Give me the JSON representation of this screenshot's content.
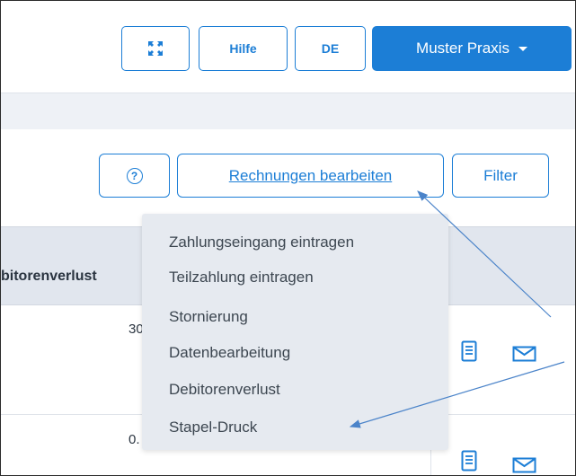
{
  "header": {
    "fullscreen_icon": "expand-arrows-icon",
    "help_label": "Hilfe",
    "lang_label": "DE",
    "practice_label": "Muster Praxis"
  },
  "toolbar": {
    "help_glyph": "?",
    "edit_invoices_label": "Rechnungen bearbeiten",
    "filter_label": "Filter"
  },
  "table": {
    "column_header": "bitorenverlust",
    "rows": [
      {
        "value": "30"
      },
      {
        "value": "0."
      }
    ]
  },
  "menu": {
    "items": [
      "Zahlungseingang eintragen",
      "Teilzahlung eintragen",
      "Stornierung",
      "Datenbearbeitung",
      "Debitorenverlust",
      "Stapel-Druck"
    ]
  },
  "colors": {
    "accent": "#1c7ed6",
    "menu_bg": "#e6eaf0",
    "header_bg": "#e1e6ee"
  }
}
